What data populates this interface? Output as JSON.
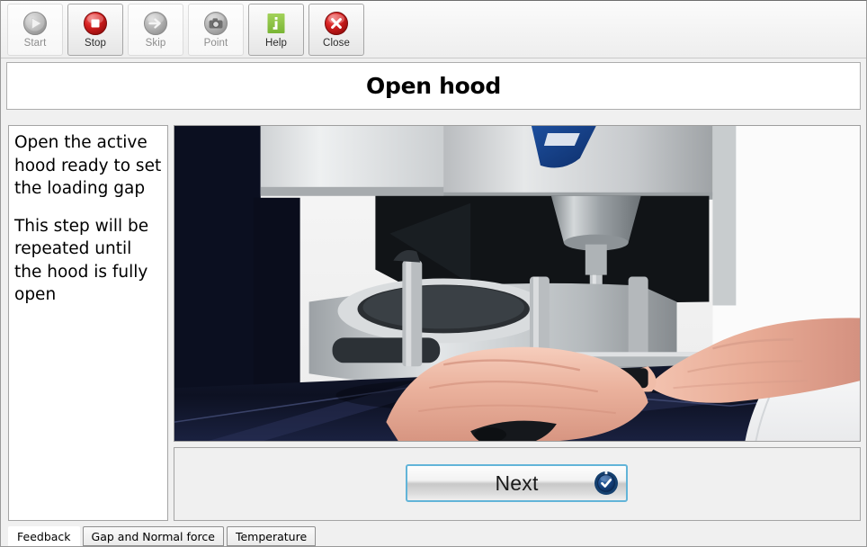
{
  "toolbar": {
    "buttons": [
      {
        "label": "Start",
        "icon": "play-icon",
        "state": "disabled"
      },
      {
        "label": "Stop",
        "icon": "stop-icon",
        "state": "enabled"
      },
      {
        "label": "Skip",
        "icon": "arrow-right-icon",
        "state": "disabled"
      },
      {
        "label": "Point",
        "icon": "camera-icon",
        "state": "disabled"
      },
      {
        "label": "Help",
        "icon": "info-icon",
        "state": "enabled"
      },
      {
        "label": "Close",
        "icon": "close-x-icon",
        "state": "enabled"
      }
    ]
  },
  "header": {
    "title": "Open hood"
  },
  "instructions": {
    "paragraph1": "Open the active hood ready to set the loading gap",
    "paragraph2": "This step will be repeated until the hood is fully open"
  },
  "photo": {
    "alt": "Hand opening the active hood of a rheometer instrument"
  },
  "actions": {
    "next_label": "Next",
    "next_icon": "check-dial-icon"
  },
  "tabs": [
    {
      "label": "Feedback",
      "active": true
    },
    {
      "label": "Gap and Normal force",
      "active": false
    },
    {
      "label": "Temperature",
      "active": false
    }
  ],
  "colors": {
    "accent_focus": "#62b4d8",
    "stop_red": "#cc1f1f",
    "help_green": "#8ac43f",
    "close_red": "#cc1f1f",
    "disabled_gray": "#9a9a9a",
    "next_icon_blue": "#123a6b"
  }
}
